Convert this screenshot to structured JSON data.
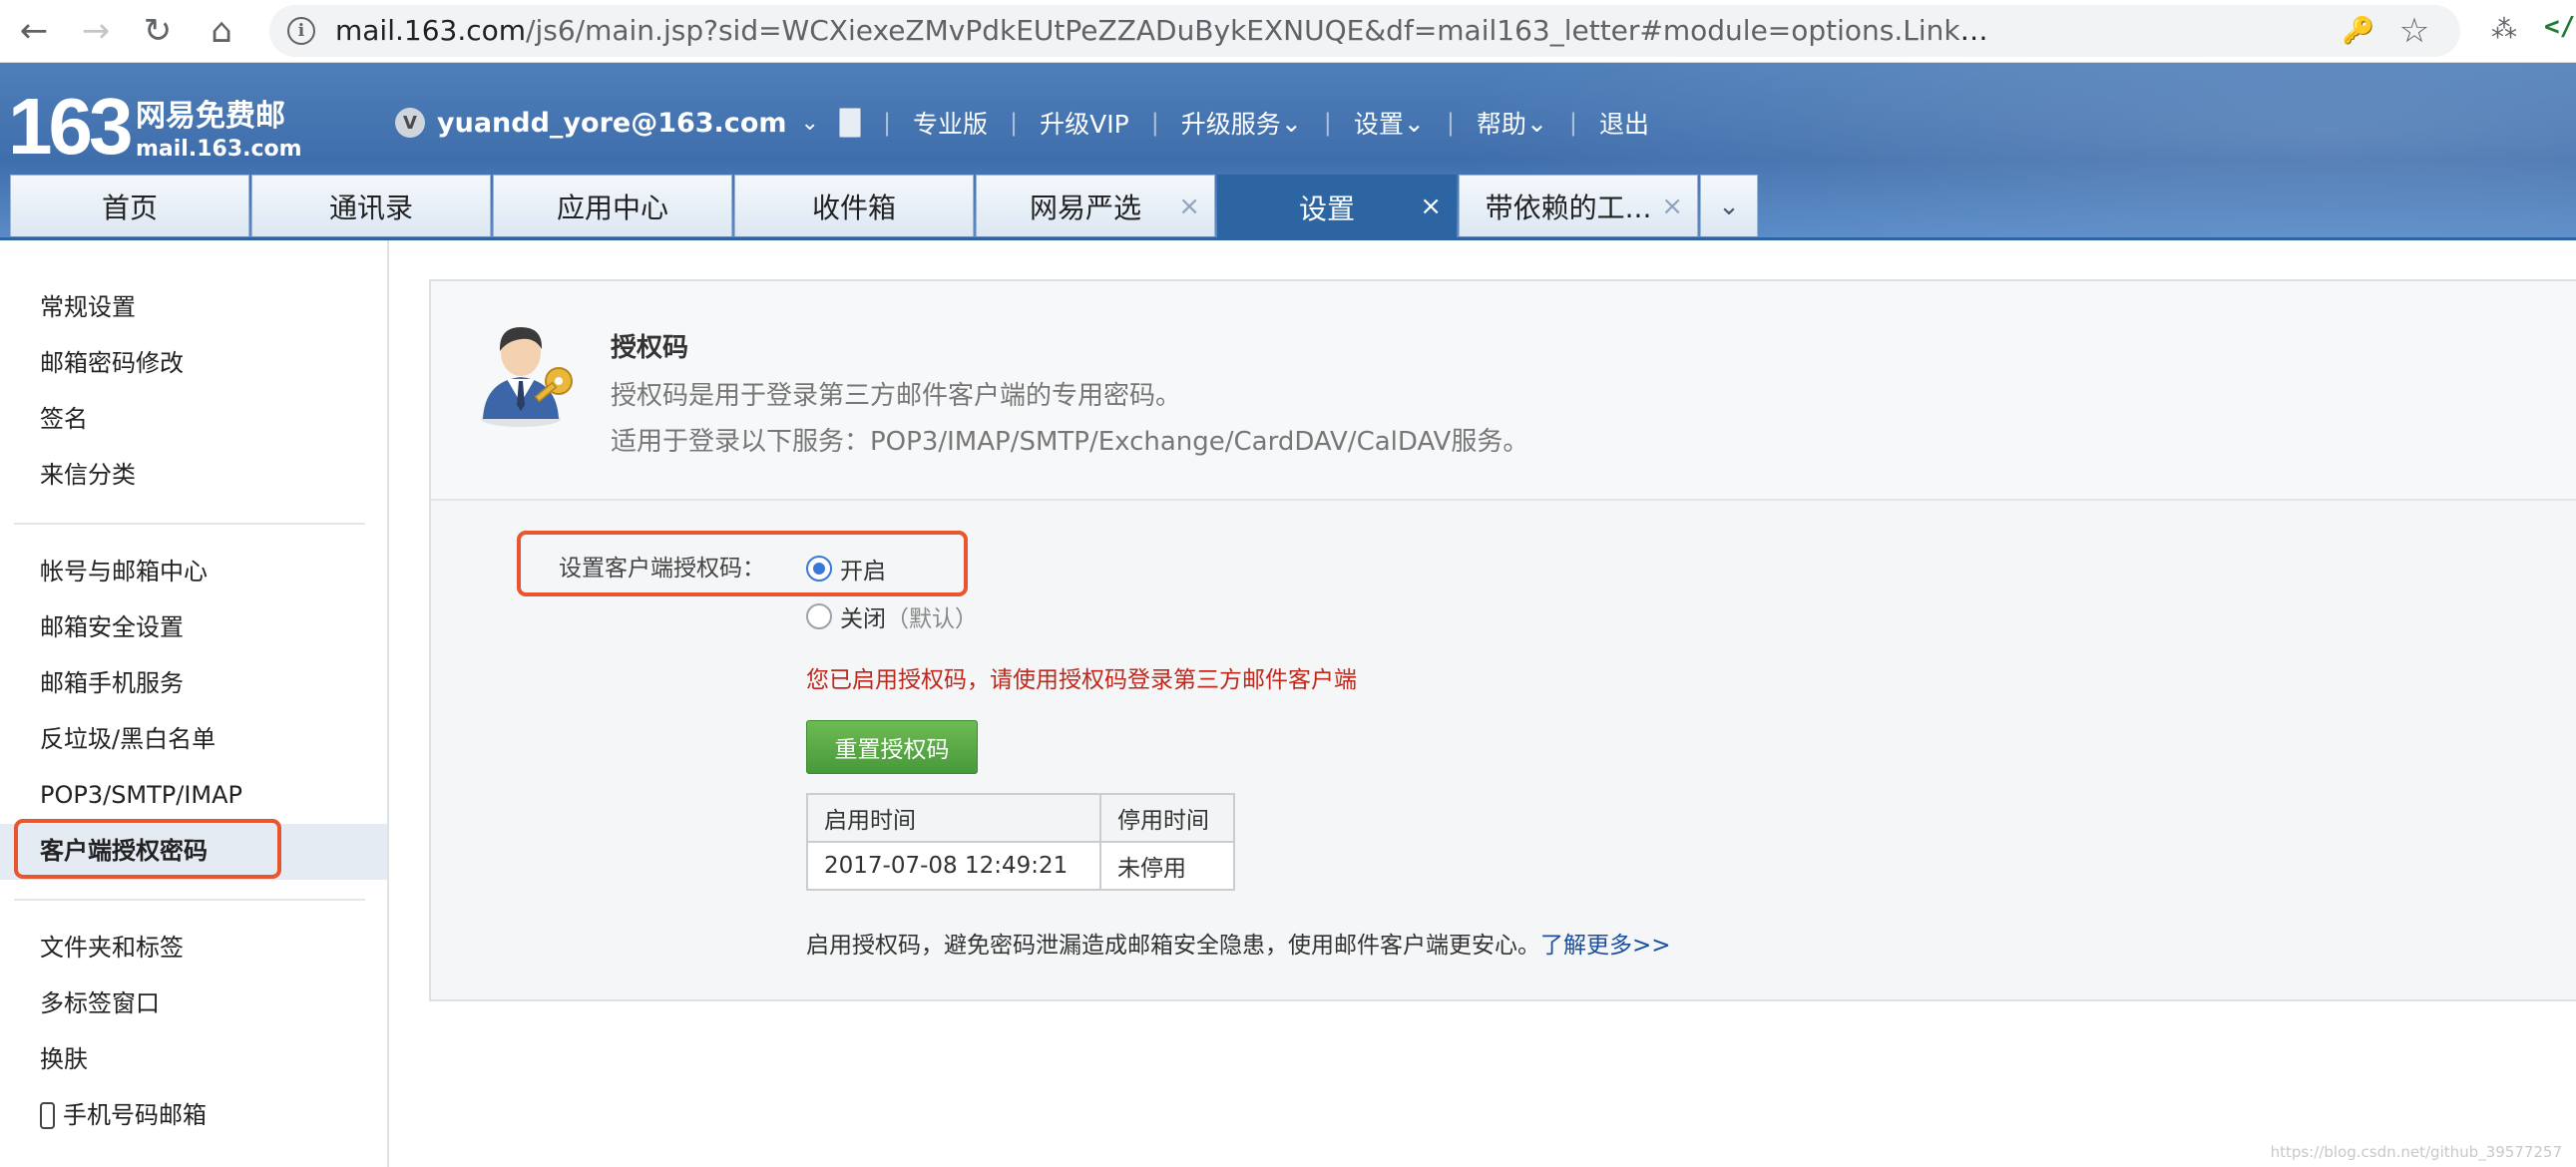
{
  "browser": {
    "url_host": "mail.163.com",
    "url_path": "/js6/main.jsp?sid=WCXiexeZMvPdkEUtPeZZADuBykEXNUQE&df=mail163_letter#module=options.LinkModule%7C%7B\"subModName\"%3A\"aut...",
    "back_icon": "←",
    "forward_icon": "→",
    "reload_icon": "↻",
    "home_icon": "⌂",
    "info_icon": "i",
    "key_icon": "🔑",
    "star_icon": "☆",
    "extension_icon": "⁂",
    "edge_text": "</"
  },
  "header": {
    "logo_number": "163",
    "logo_name": "网易免费邮",
    "logo_domain": "mail.163.com",
    "vip_badge": "V",
    "user_email": "yuandd_yore@163.com",
    "user_caret": "⌄",
    "links": [
      {
        "label": "专业版"
      },
      {
        "label": "升级VIP"
      },
      {
        "label": "升级服务",
        "caret": "⌄"
      },
      {
        "label": "设置",
        "caret": "⌄"
      },
      {
        "label": "帮助",
        "caret": "⌄"
      },
      {
        "label": "退出"
      }
    ],
    "tabs": [
      {
        "label": "首页",
        "close": ""
      },
      {
        "label": "通讯录",
        "close": ""
      },
      {
        "label": "应用中心",
        "close": ""
      },
      {
        "label": "收件箱",
        "close": ""
      },
      {
        "label": "网易严选",
        "close": "×"
      },
      {
        "label": "设置",
        "close": "×"
      },
      {
        "label": "带依赖的工...",
        "close": "×"
      }
    ],
    "tab_more": "⌄"
  },
  "sidebar": {
    "group1": [
      "常规设置",
      "邮箱密码修改",
      "签名",
      "来信分类"
    ],
    "group2": [
      "帐号与邮箱中心",
      "邮箱安全设置",
      "邮箱手机服务",
      "反垃圾/黑白名单",
      "POP3/SMTP/IMAP",
      "客户端授权密码"
    ],
    "group3": [
      "文件夹和标签",
      "多标签窗口",
      "换肤",
      "手机号码邮箱"
    ],
    "active": "客户端授权密码"
  },
  "main": {
    "title": "授权码",
    "desc1": "授权码是用于登录第三方邮件客户端的专用密码。",
    "desc2": "适用于登录以下服务：POP3/IMAP/SMTP/Exchange/CardDAV/CalDAV服务。",
    "setting_label": "设置客户端授权码：",
    "option_on": "开启",
    "option_off": "关闭",
    "option_off_note": "（默认）",
    "selected": "开启",
    "status_message": "您已启用授权码，请使用授权码登录第三方邮件客户端",
    "reset_button": "重置授权码",
    "table": {
      "headers": [
        "启用时间",
        "停用时间"
      ],
      "rows": [
        [
          "2017-07-08 12:49:21",
          "未停用"
        ]
      ]
    },
    "note": "启用授权码，避免密码泄漏造成邮箱安全隐患，使用邮件客户端更安心。",
    "learn_more": "了解更多>>"
  },
  "watermark": "https://blog.csdn.net/github_39577257",
  "colors": {
    "header_blue": "#3f6eac",
    "active_tab": "#2d65a3",
    "highlight_border": "#e8552f",
    "warning_red": "#c0281b",
    "button_green": "#47993a",
    "link_blue": "#1a4fa0"
  }
}
